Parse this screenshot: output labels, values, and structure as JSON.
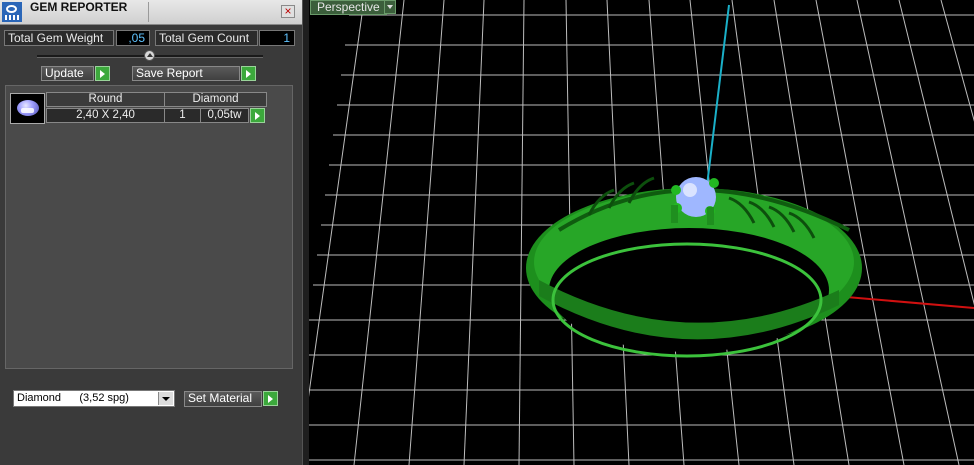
{
  "panel": {
    "title": "GEM REPORTER",
    "close_icon": "close-icon",
    "app_icon": "gem-reporter-icon",
    "total_weight_label": "Total Gem Weight",
    "total_weight_value": ",05",
    "total_count_label": "Total Gem Count",
    "total_count_value": "1",
    "slider_level": 0.5,
    "update_label": "Update",
    "save_report_label": "Save Report",
    "table": {
      "shape": "Round",
      "material": "Diamond",
      "size": "2,40 X 2,40",
      "count": "1",
      "weight": "0,05tw"
    },
    "material_select": "Diamond      (3,52 spg)",
    "set_material_label": "Set Material"
  },
  "viewport": {
    "view_label": "Perspective",
    "colors": {
      "grid": "#bdbdbd",
      "axis_x": "#d01010",
      "axis_z": "#1ab0c8",
      "ring": "#1f9a1f",
      "gem": "#9fb7ff",
      "accent": "#3ca93c"
    }
  }
}
